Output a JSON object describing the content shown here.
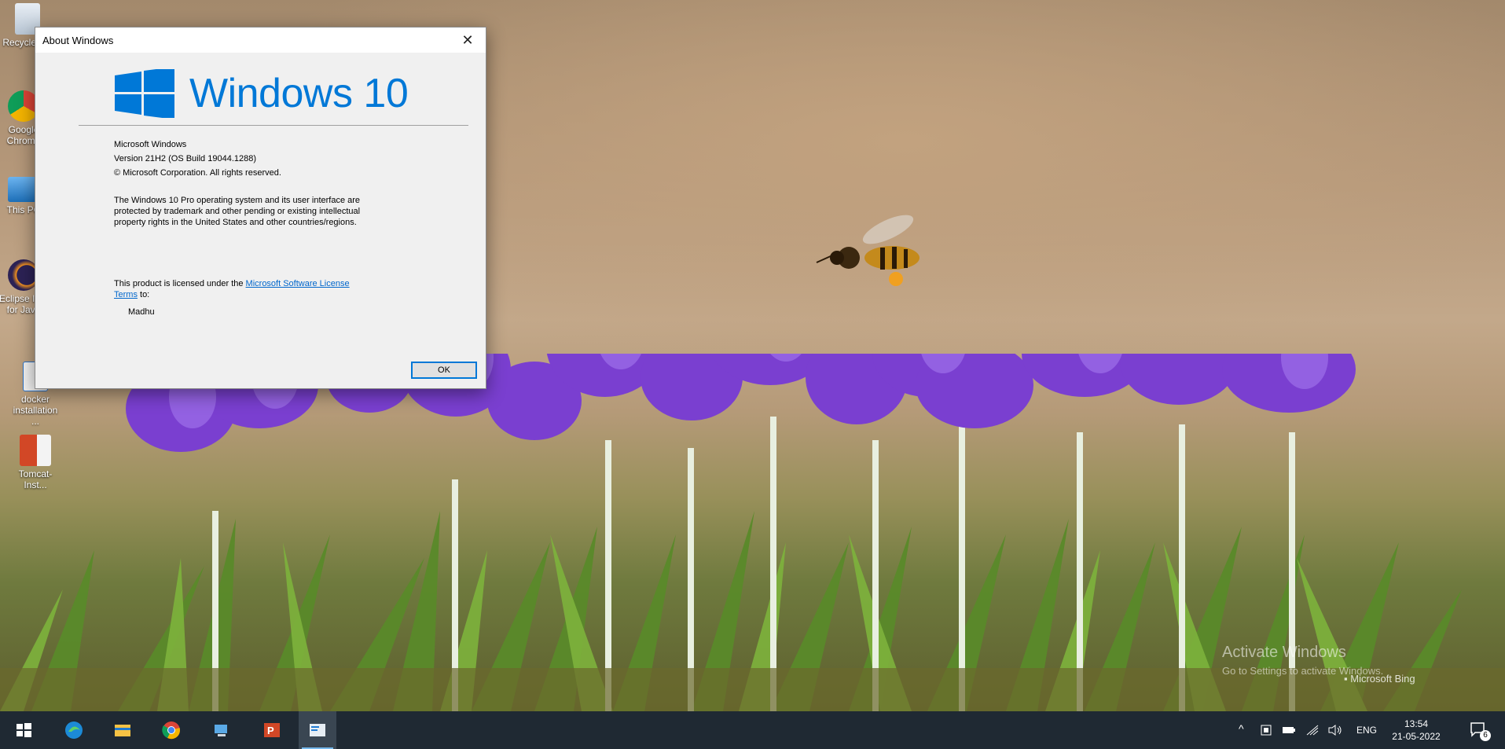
{
  "dialog": {
    "title": "About Windows",
    "close_glyph": "✕",
    "logo_text": "Windows 10",
    "product": "Microsoft Windows",
    "version": "Version 21H2 (OS Build 19044.1288)",
    "copyright": "© Microsoft Corporation. All rights reserved.",
    "description_1": "The Windows 10 Pro operating system and its user interface are",
    "description_2": "protected by trademark and other pending or existing intellectual",
    "description_3": "property rights in the United States and other countries/regions.",
    "license_prefix": "This product is licensed under the",
    "license_link_1": "Microsoft Software License",
    "license_link_2": "Terms",
    "license_suffix": " to:",
    "licensee": "Madhu",
    "ok_label": "OK"
  },
  "desktop": {
    "icons": [
      {
        "label": "Recycle Bin",
        "icon": "recycle-bin-icon"
      },
      {
        "label": "Google Chrome",
        "icon": "chrome-icon"
      },
      {
        "label": "This PC",
        "icon": "this-pc-icon"
      },
      {
        "label": "Eclipse IDE for Java",
        "icon": "eclipse-icon"
      },
      {
        "label": "docker installation ...",
        "icon": "document-icon"
      },
      {
        "label": "Tomcat-Inst...",
        "icon": "powerpoint-icon"
      }
    ],
    "watermark_title": "Activate Windows",
    "watermark_sub": "Go to Settings to activate Windows.",
    "bing_label": "Microsoft Bing"
  },
  "taskbar": {
    "apps": [
      {
        "name": "start",
        "icon": "windows-start-icon"
      },
      {
        "name": "edge",
        "icon": "edge-icon"
      },
      {
        "name": "file-explorer",
        "icon": "folder-icon"
      },
      {
        "name": "chrome",
        "icon": "chrome-icon"
      },
      {
        "name": "remote-desktop",
        "icon": "remote-desktop-icon"
      },
      {
        "name": "powerpoint",
        "icon": "powerpoint-icon"
      },
      {
        "name": "winver",
        "icon": "winver-icon"
      }
    ],
    "tray": {
      "language": "ENG",
      "time": "13:54",
      "date": "21-05-2022",
      "notification_count": "6"
    }
  },
  "colors": {
    "accent": "#0078d7",
    "taskbar": "#1f2933",
    "dialog_bg": "#f0f0f0"
  }
}
